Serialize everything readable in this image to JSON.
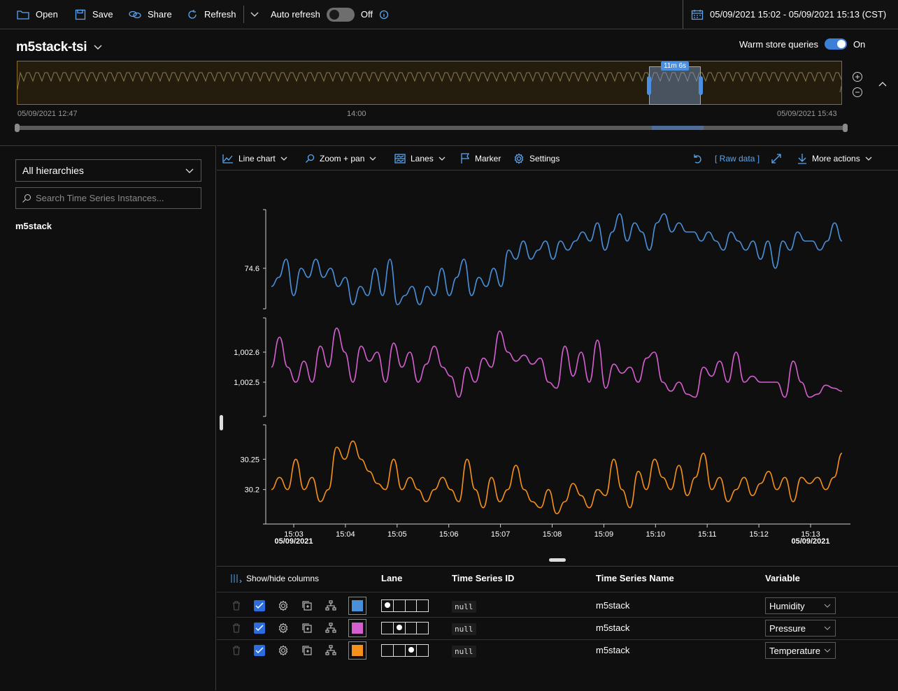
{
  "toolbar": {
    "open": "Open",
    "save": "Save",
    "share": "Share",
    "refresh": "Refresh",
    "auto_refresh": "Auto refresh",
    "auto_refresh_state": "Off",
    "date_range": "05/09/2021 15:02 - 05/09/2021 15:13 (CST)"
  },
  "environment": {
    "name": "m5stack-tsi",
    "warm_store_label": "Warm store queries",
    "warm_store_state": "On",
    "brush_label": "11m 6s",
    "timeline_start": "05/09/2021 12:47",
    "timeline_mid": "14:00",
    "timeline_end": "05/09/2021 15:43"
  },
  "left_panel": {
    "hierarchy_select": "All hierarchies",
    "search_placeholder": "Search Time Series Instances...",
    "instance": "m5stack"
  },
  "chart_toolbar": {
    "line_chart": "Line chart",
    "zoom_pan": "Zoom + pan",
    "lanes": "Lanes",
    "marker": "Marker",
    "settings": "Settings",
    "raw_data": "[ Raw data ]",
    "more_actions": "More actions"
  },
  "colors": {
    "humidity": "#4a90d9",
    "pressure": "#d45fcf",
    "temperature": "#f5901b",
    "accent": "#5aa6f0"
  },
  "chart_data": {
    "type": "line",
    "x_ticks": [
      "15:03",
      "15:04",
      "15:05",
      "15:06",
      "15:07",
      "15:08",
      "15:09",
      "15:10",
      "15:11",
      "15:12",
      "15:13"
    ],
    "x_date_labels": [
      "05/09/2021",
      "05/09/2021"
    ],
    "lanes": [
      {
        "name": "Humidity",
        "color": "#4a90d9",
        "yticks": [
          "74.6"
        ],
        "ylim": [
          74.2,
          75.2
        ],
        "values": [
          74.4,
          74.5,
          74.7,
          74.3,
          74.6,
          74.5,
          74.7,
          74.5,
          74.6,
          74.4,
          74.5,
          74.2,
          74.4,
          74.3,
          74.6,
          74.3,
          74.7,
          74.2,
          74.3,
          74.4,
          74.2,
          74.4,
          74.3,
          74.6,
          74.3,
          74.5,
          74.7,
          74.3,
          74.5,
          74.4,
          74.6,
          74.4,
          74.8,
          74.7,
          74.9,
          74.7,
          74.8,
          74.9,
          74.7,
          74.9,
          74.8,
          74.9,
          75.0,
          74.9,
          75.1,
          74.8,
          75.0,
          75.2,
          74.9,
          75.1,
          75.0,
          74.8,
          75.1,
          75.2,
          75.0,
          75.1,
          75.0,
          75.0,
          74.9,
          75.0,
          74.9,
          74.8,
          75.0,
          74.9,
          74.8,
          74.9,
          74.7,
          74.9,
          74.6,
          74.9,
          74.8,
          75.0,
          74.9,
          74.9,
          74.8,
          74.9,
          75.1,
          74.9
        ],
        "series_label": "Humidity"
      },
      {
        "name": "Pressure",
        "color": "#d45fcf",
        "yticks": [
          "1,002.6",
          "1,002.5"
        ],
        "ylim": [
          1002.4,
          1002.7
        ],
        "values": [
          1002.55,
          1002.65,
          1002.55,
          1002.5,
          1002.57,
          1002.5,
          1002.62,
          1002.55,
          1002.68,
          1002.6,
          1002.5,
          1002.62,
          1002.57,
          1002.6,
          1002.5,
          1002.63,
          1002.55,
          1002.6,
          1002.5,
          1002.56,
          1002.62,
          1002.55,
          1002.52,
          1002.45,
          1002.55,
          1002.5,
          1002.58,
          1002.55,
          1002.67,
          1002.6,
          1002.57,
          1002.59,
          1002.56,
          1002.58,
          1002.5,
          1002.48,
          1002.62,
          1002.52,
          1002.6,
          1002.5,
          1002.64,
          1002.48,
          1002.56,
          1002.53,
          1002.55,
          1002.5,
          1002.58,
          1002.6,
          1002.5,
          1002.47,
          1002.5,
          1002.46,
          1002.45,
          1002.55,
          1002.52,
          1002.57,
          1002.5,
          1002.6,
          1002.5,
          1002.52,
          1002.5,
          1002.5,
          1002.5,
          1002.45,
          1002.57,
          1002.5,
          1002.45,
          1002.46,
          1002.49,
          1002.48,
          1002.47
        ],
        "series_label": "Pressure"
      },
      {
        "name": "Temperature",
        "color": "#f5901b",
        "yticks": [
          "30.25",
          "30.2"
        ],
        "ylim": [
          30.15,
          30.3
        ],
        "values": [
          30.2,
          30.22,
          30.2,
          30.25,
          30.2,
          30.22,
          30.18,
          30.2,
          30.27,
          30.25,
          30.28,
          30.25,
          30.23,
          30.21,
          30.2,
          30.25,
          30.2,
          30.22,
          30.2,
          30.18,
          30.2,
          30.22,
          30.2,
          30.18,
          30.25,
          30.2,
          30.17,
          30.22,
          30.18,
          30.2,
          30.24,
          30.2,
          30.18,
          30.17,
          30.2,
          30.16,
          30.18,
          30.21,
          30.19,
          30.17,
          30.2,
          30.19,
          30.25,
          30.2,
          30.17,
          30.23,
          30.2,
          30.25,
          30.22,
          30.2,
          30.24,
          30.19,
          30.22,
          30.26,
          30.2,
          30.22,
          30.18,
          30.2,
          30.22,
          30.19,
          30.21,
          30.23,
          30.2,
          30.22,
          30.18,
          30.22,
          30.21,
          30.22,
          30.2,
          30.22,
          30.26
        ],
        "series_label": "Temperature"
      }
    ]
  },
  "table": {
    "show_hide": "Show/hide columns",
    "headers": {
      "lane": "Lane",
      "ts_id": "Time Series ID",
      "ts_name": "Time Series Name",
      "variable": "Variable"
    },
    "rows": [
      {
        "ts_id": "null",
        "ts_name": "m5stack",
        "variable": "Humidity",
        "color": "#4a90d9"
      },
      {
        "ts_id": "null",
        "ts_name": "m5stack",
        "variable": "Pressure",
        "color": "#d45fcf"
      },
      {
        "ts_id": "null",
        "ts_name": "m5stack",
        "variable": "Temperature",
        "color": "#f5901b"
      }
    ]
  }
}
